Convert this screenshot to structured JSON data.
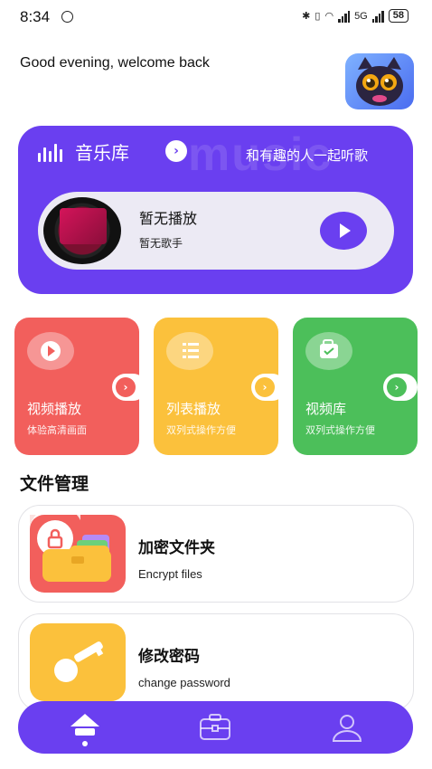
{
  "status_bar": {
    "time": "8:34",
    "network": "5G",
    "battery": "58"
  },
  "greeting": "Good evening, welcome back",
  "music_card": {
    "watermark": "music",
    "title": "音乐库",
    "arrow": "›",
    "slogan": "和有趣的人一起听歌",
    "song_name": "暂无播放",
    "singer": "暂无歌手"
  },
  "tiles": [
    {
      "title": "视频播放",
      "subtitle": "体验高清画面",
      "color": "#f25f5c",
      "icon": "play-icon"
    },
    {
      "title": "列表播放",
      "subtitle": "双列式操作方便",
      "color": "#fbc13c",
      "icon": "list-icon"
    },
    {
      "title": "视频库",
      "subtitle": "双列式操作方便",
      "color": "#4cbf5a",
      "icon": "bag-icon"
    }
  ],
  "section_title": "文件管理",
  "file_items": [
    {
      "name": "加密文件夹",
      "subtitle": "Encrypt files",
      "color": "#f25f5c",
      "icon": "lock-icon"
    },
    {
      "name": "修改密码",
      "subtitle": "change password",
      "color": "#fbc13c",
      "icon": "key-icon"
    }
  ],
  "bottom_nav": {
    "items": [
      "home-icon",
      "toolbox-icon",
      "profile-icon"
    ],
    "active": "home-icon"
  },
  "colors": {
    "accent": "#6a3ff0",
    "red": "#f25f5c",
    "yellow": "#fbc13c",
    "green": "#4cbf5a"
  }
}
